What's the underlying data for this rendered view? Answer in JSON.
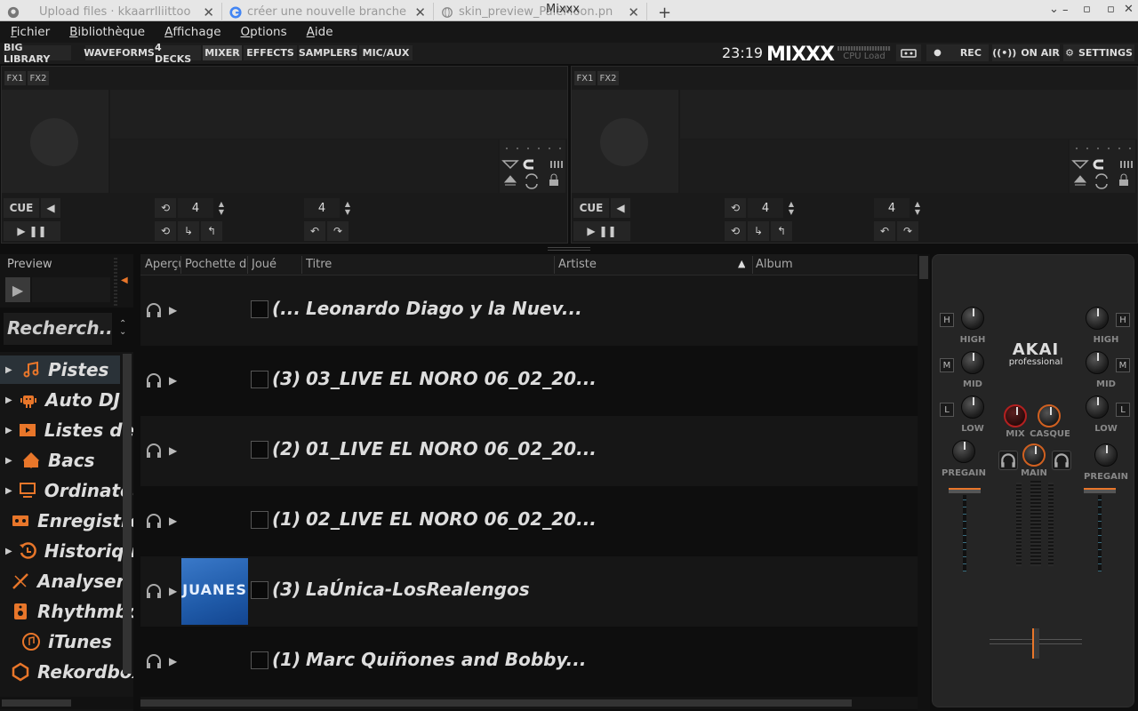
{
  "browser": {
    "tabs": [
      {
        "title": "Upload files · kkaarrlliittoo",
        "icon": "github-icon"
      },
      {
        "title": "créer une nouvelle branche",
        "icon": "google-icon"
      },
      {
        "title": "skin_preview_PaleMoon.pn",
        "icon": "globe-icon"
      }
    ],
    "new_tab": "+",
    "window_title": "Mixxx",
    "window_controls": [
      "⌄",
      "–",
      "▫",
      "✕"
    ]
  },
  "menu": [
    {
      "label": "Fichier",
      "u": "F"
    },
    {
      "label": "Bibliothèque",
      "u": "B"
    },
    {
      "label": "Affichage",
      "u": "A"
    },
    {
      "label": "Options",
      "u": "O"
    },
    {
      "label": "Aide",
      "u": "A"
    }
  ],
  "toolbar": {
    "big_library": "BIG LIBRARY",
    "waveforms": "WAVEFORMS",
    "four_decks": "4 DECKS",
    "mixer": "MIXER",
    "effects": "EFFECTS",
    "samplers": "SAMPLERS",
    "mic_aux": "MIC/AUX",
    "clock": "23:19",
    "logo": "MIXXX",
    "cpu_load": "CPU Load",
    "rec": "REC",
    "on_air": "ON AIR",
    "settings": "SETTINGS"
  },
  "decks": [
    {
      "fx1": "FX1",
      "fx2": "FX2",
      "cue": "CUE",
      "beatloop": "4",
      "beatjump": "4"
    },
    {
      "fx1": "FX1",
      "fx2": "FX2",
      "cue": "CUE",
      "beatloop": "4",
      "beatjump": "4"
    }
  ],
  "preview": {
    "label": "Preview"
  },
  "search": {
    "placeholder": "Recherch..."
  },
  "sidebar": {
    "items": [
      {
        "label": "Pistes",
        "icon": "music-note-icon",
        "expandable": true,
        "selected": true
      },
      {
        "label": "Auto DJ",
        "icon": "robot-icon",
        "expandable": true
      },
      {
        "label": "Listes de",
        "icon": "playlist-icon",
        "expandable": true
      },
      {
        "label": "Bacs",
        "icon": "crate-icon",
        "expandable": true
      },
      {
        "label": "Ordinateur",
        "icon": "computer-icon",
        "expandable": true
      },
      {
        "label": "Enregistrements",
        "icon": "recording-icon",
        "expandable": false
      },
      {
        "label": "Historique",
        "icon": "history-icon",
        "expandable": true
      },
      {
        "label": "Analyser",
        "icon": "analyze-icon",
        "expandable": false
      },
      {
        "label": "Rhythmbox",
        "icon": "rhythmbox-icon",
        "expandable": false
      },
      {
        "label": "iTunes",
        "icon": "itunes-icon",
        "expandable": false
      },
      {
        "label": "Rekordbox",
        "icon": "rekordbox-icon",
        "expandable": false
      }
    ]
  },
  "library": {
    "columns": [
      "Aperçu",
      "Pochette d",
      "Joué",
      "Titre",
      "Artiste",
      "Album"
    ],
    "sort_indicator": "▲",
    "rows": [
      {
        "played": "(...",
        "title": "Leonardo Diago y la Nuev...",
        "cover": false
      },
      {
        "played": "(3)",
        "title": "03_LIVE EL NORO 06_02_20...",
        "cover": false
      },
      {
        "played": "(2)",
        "title": "01_LIVE EL NORO 06_02_20...",
        "cover": false
      },
      {
        "played": "(1)",
        "title": "02_LIVE EL NORO 06_02_20...",
        "cover": false
      },
      {
        "played": "(3)",
        "title": "LaÚnica-LosRealengos",
        "cover": true,
        "cover_text": "JUANES"
      },
      {
        "played": "(1)",
        "title": "Marc Quiñones and Bobby...",
        "cover": false
      }
    ]
  },
  "mixer": {
    "high": "HIGH",
    "mid": "MID",
    "low": "LOW",
    "pregain": "PREGAIN",
    "mix": "MIX",
    "casque": "CASQUE",
    "main": "MAIN",
    "h": "H",
    "m": "M",
    "l": "L",
    "brand": "AKAI",
    "brand_sub": "professional"
  },
  "colors": {
    "accent": "#e8762a",
    "background": "#0e0e0e",
    "selected": "#2a3238"
  }
}
